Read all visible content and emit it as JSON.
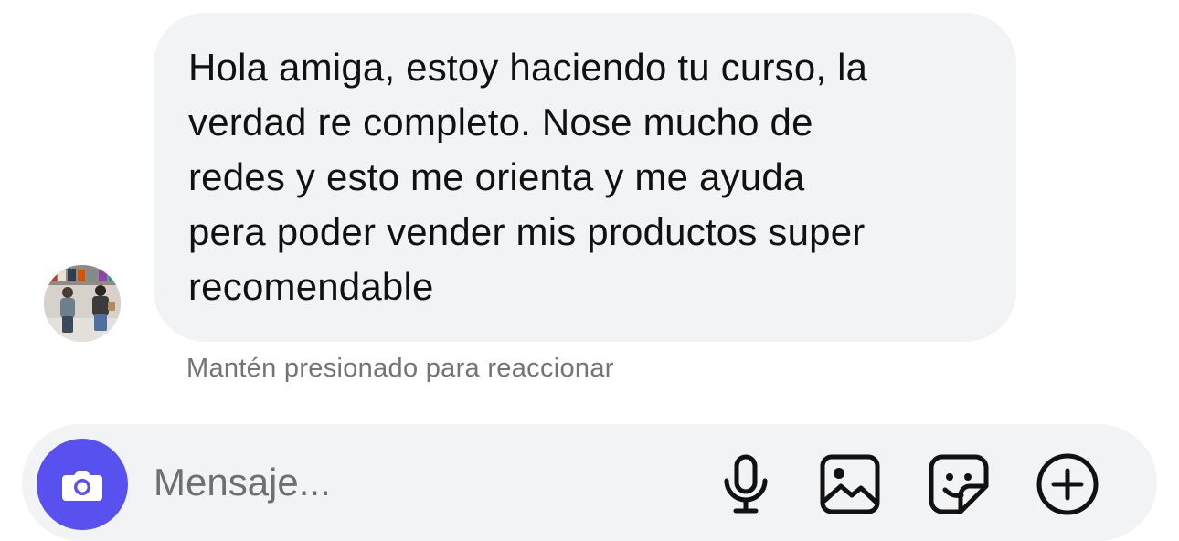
{
  "conversation": {
    "incoming_message": {
      "text": "Hola amiga, estoy haciendo tu curso, la\nverdad re completo. Nose mucho de\nredes y esto me orienta y me ayuda\npera poder vender mis productos super\nrecomendable"
    },
    "reaction_hint": "Mantén presionado para reaccionar"
  },
  "composer": {
    "placeholder": "Mensaje...",
    "value": "",
    "icons": [
      "camera-icon",
      "microphone-icon",
      "image-gallery-icon",
      "sticker-icon",
      "plus-circle-icon"
    ],
    "accent_color": "#5851f0"
  }
}
